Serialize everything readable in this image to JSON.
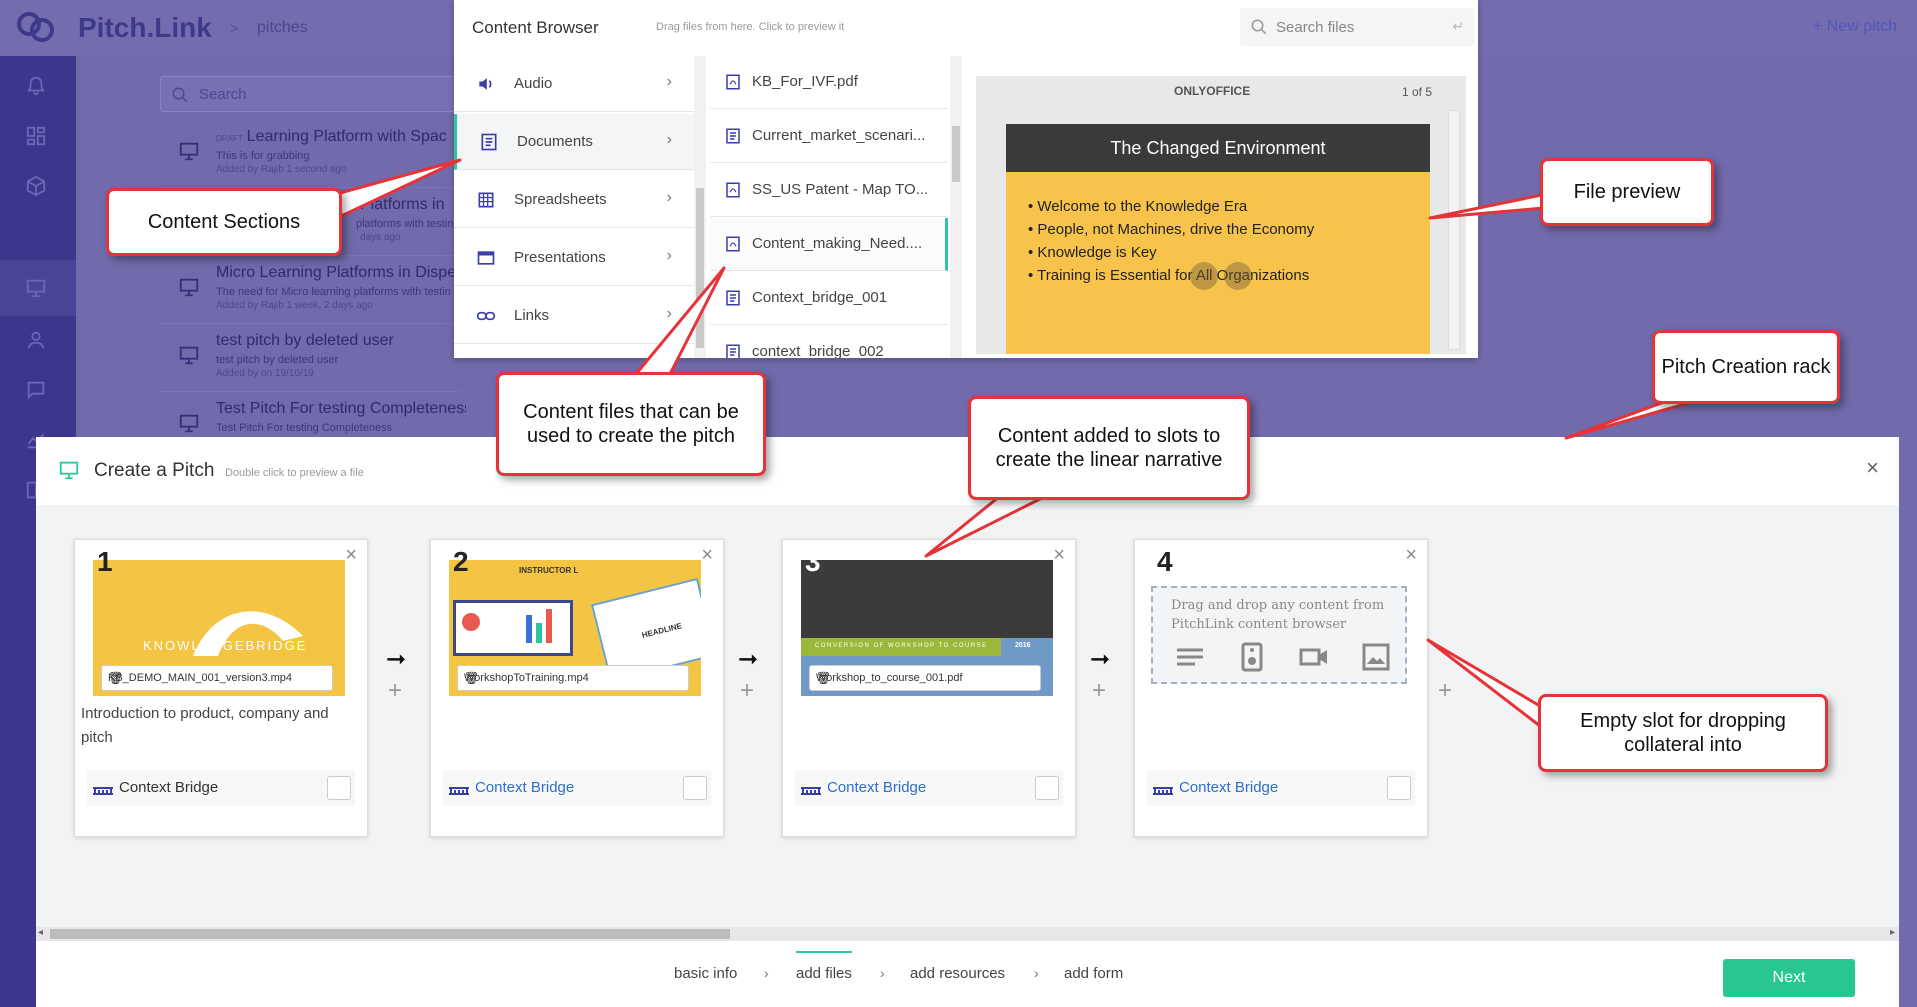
{
  "app": {
    "brand": "Pitch.Link",
    "breadcrumb_sep": ">",
    "breadcrumb": "pitches",
    "new_pitch": "+ New pitch"
  },
  "background_list": {
    "search_placeholder": "Search",
    "items": [
      {
        "badge": "DRAFT",
        "title": "Learning Platform with Spac",
        "subtitle": "This is for grabbing",
        "meta": "Added by Rajib 1 second ago"
      },
      {
        "title": "Platforms in",
        "subtitle": "platforms with testin",
        "meta": "days ago"
      },
      {
        "title": "Micro Learning Platforms in Dispe",
        "subtitle": "The need for Micro learning platforms with testin",
        "meta": "Added by Rajib 1 week, 2 days ago"
      },
      {
        "title": "test pitch by deleted user",
        "subtitle": "test pitch by deleted user",
        "meta": "Added by on 19/10/19"
      },
      {
        "title": "Test Pitch For testing Completeness",
        "subtitle": "Test Pitch For testing Completeness",
        "meta": ""
      }
    ]
  },
  "content_browser": {
    "title": "Content Browser",
    "hint": "Drag files from here. Click to preview it",
    "search_placeholder": "Search files",
    "return_glyph": "↵",
    "sections": [
      {
        "label": "Audio",
        "icon": "speaker-icon"
      },
      {
        "label": "Documents",
        "icon": "document-icon",
        "active": true
      },
      {
        "label": "Spreadsheets",
        "icon": "grid-icon"
      },
      {
        "label": "Presentations",
        "icon": "presentation-icon"
      },
      {
        "label": "Links",
        "icon": "link-icon"
      }
    ],
    "chevron": "›",
    "files": [
      {
        "name": "KB_For_IVF.pdf",
        "type": "pdf"
      },
      {
        "name": "Current_market_scenari...",
        "type": "doc"
      },
      {
        "name": "SS_US Patent - Map TO...",
        "type": "pdf"
      },
      {
        "name": "Content_making_Need....",
        "type": "pdf",
        "active": true
      },
      {
        "name": "Context_bridge_001",
        "type": "doc"
      },
      {
        "name": "context_bridge_002",
        "type": "doc"
      }
    ],
    "preview": {
      "logo": "ONLYOFFICE",
      "page": "1 of 5",
      "slide_title": "The Changed Environment",
      "bullets": [
        "Welcome to the Knowledge Era",
        "People, not Machines, drive the Economy",
        "Knowledge is Key",
        "Training is Essential for All Organizations"
      ]
    }
  },
  "pitch_panel": {
    "title": "Create a Pitch",
    "subtitle": "Double click to preview a file",
    "close": "×",
    "slots": [
      {
        "number": "1",
        "file": "KB_DEMO_MAIN_001_version3.mp4",
        "description": "Introduction to product, company and pitch",
        "context": "Context Bridge",
        "thumb_text": "KNOWLEDGEBRIDGE"
      },
      {
        "number": "2",
        "file": "WorkshopToTraining.mp4",
        "description": "",
        "context": "Context Bridge",
        "thumb_text": "INSTRUCTOR L",
        "thumb_text2": "HEADLINE"
      },
      {
        "number": "3",
        "file": "Workshop_to_course_001.pdf",
        "description": "",
        "context": "Context Bridge",
        "thumb_text": "CONVERSION OF WORKSHOP TO COURSE",
        "thumb_year": "2016"
      },
      {
        "number": "4",
        "file": "",
        "description": "",
        "context": "Context Bridge",
        "dropzone_text": "Drag and drop any content from PitchLink content browser"
      }
    ],
    "close_glyph": "×",
    "trash_glyph": "🗑",
    "arrow_glyph": "➞",
    "plus_glyph": "+",
    "steps": [
      "basic info",
      "add files",
      "add resources",
      "add form"
    ],
    "step_sep": "›",
    "active_step": "add files",
    "next": "Next"
  },
  "annotations": {
    "content_sections": "Content Sections",
    "file_preview": "File preview",
    "pitch_rack": "Pitch Creation rack",
    "content_files": "Content files that can be used to create the pitch",
    "content_added": "Content added to slots to create the linear narrative",
    "empty_slot": "Empty slot for dropping collateral into"
  },
  "colors": {
    "accent": "#2ec5a3",
    "callout_border": "#e6333a",
    "sidebar": "#3c378d",
    "next_button": "#27c78f",
    "link": "#2d6fc7"
  }
}
